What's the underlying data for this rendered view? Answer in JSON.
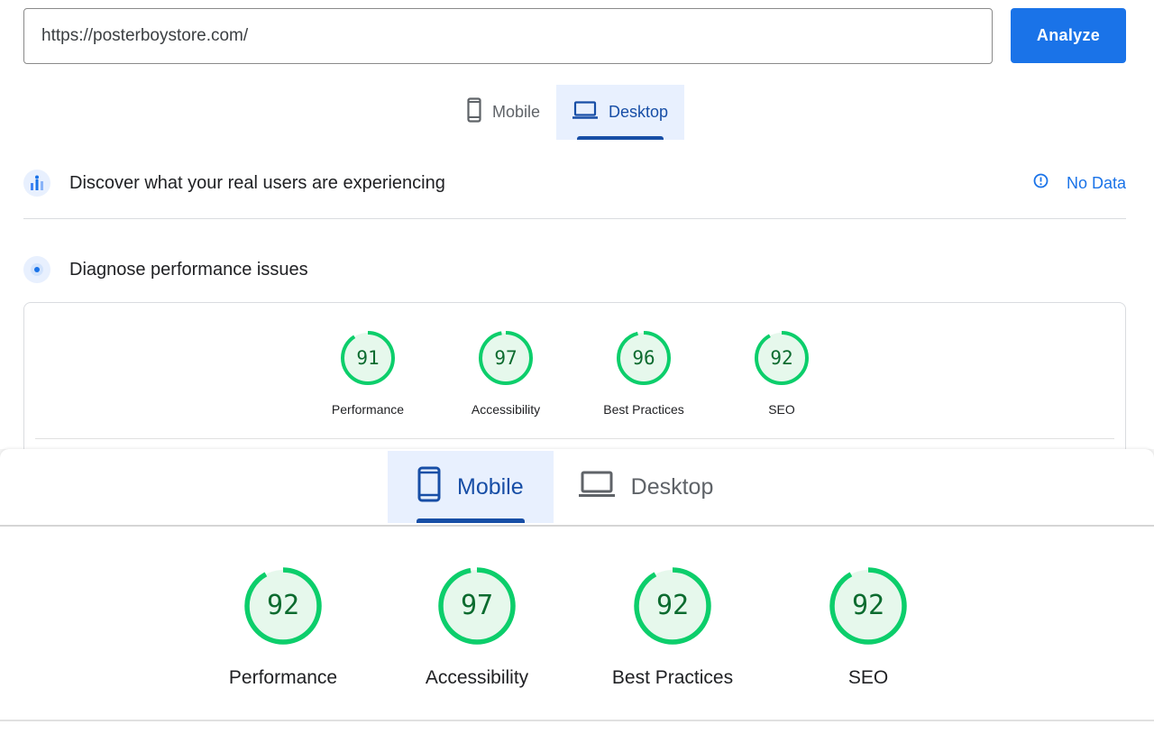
{
  "url_input": {
    "value": "https://posterboystore.com/"
  },
  "analyze_label": "Analyze",
  "top_tabs": {
    "mobile": "Mobile",
    "desktop": "Desktop"
  },
  "field_data": {
    "title": "Discover what your real users are experiencing",
    "status": "No Data"
  },
  "diagnose": {
    "title": "Diagnose performance issues"
  },
  "desktop_scores": [
    {
      "label": "Performance",
      "score": "91"
    },
    {
      "label": "Accessibility",
      "score": "97"
    },
    {
      "label": "Best Practices",
      "score": "96"
    },
    {
      "label": "SEO",
      "score": "92"
    }
  ],
  "bottom_tabs": {
    "mobile": "Mobile",
    "desktop": "Desktop"
  },
  "mobile_scores": [
    {
      "label": "Performance",
      "score": "92"
    },
    {
      "label": "Accessibility",
      "score": "97"
    },
    {
      "label": "Best Practices",
      "score": "92"
    },
    {
      "label": "SEO",
      "score": "92"
    }
  ],
  "colors": {
    "accent": "#1a73e8",
    "active_tab": "#174ea6",
    "tab_bg": "#e8f0fe",
    "score_ring": "#0cce6b",
    "score_fill": "#e6f8ec",
    "score_text": "#0c6b2f"
  }
}
